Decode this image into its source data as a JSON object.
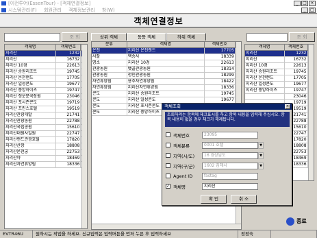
{
  "window": {
    "title": "[이전투어(EssenTour) - [객체연결정보]",
    "menu": [
      "시스템관리(F)",
      "회원관리",
      "객체정보관리",
      "창(W)"
    ]
  },
  "header": {
    "title": "객체연결정보"
  },
  "left": {
    "search_btn": "조 회",
    "col_name": "객체명",
    "col_no": "객체번호",
    "rows": [
      [
        "지리산",
        "1232"
      ],
      [
        "지리산",
        "16732"
      ],
      [
        "지리산 10경",
        "22613"
      ],
      [
        "지리산 송원리조트",
        "19745"
      ],
      [
        "지리산 온천랜드",
        "17705"
      ],
      [
        "지리산 일성콘도",
        "19677"
      ],
      [
        "지리산 중앙하이츠",
        "19747"
      ],
      [
        "지리산 청운분국장원",
        "23046"
      ],
      [
        "지리산 포시즌콘도",
        "19719"
      ],
      [
        "지리산 프린스호텔",
        "19519"
      ],
      [
        "지리산관광개발",
        "21741"
      ],
      [
        "지리산관광농원",
        "22788"
      ],
      [
        "지리산국립공원",
        "15610"
      ],
      [
        "지리산대원사일원",
        "22747"
      ],
      [
        "지리산랜드관광호텔",
        "17820"
      ],
      [
        "지리산산장",
        "18808"
      ],
      [
        "지리산온천궁",
        "22753"
      ],
      [
        "지리산야",
        "18469"
      ],
      [
        "지리산자연휴양림",
        "18336"
      ]
    ]
  },
  "tabs": [
    "상위 객체",
    "동등 객체",
    "하위 객체"
  ],
  "middle": {
    "col_class": "분류",
    "col_name": "객체명",
    "col_no": "객체번호",
    "rows": [
      [
        "온천",
        "지리산 온천랜드",
        "17705"
      ],
      [
        "사찰",
        "백승사",
        "18339"
      ],
      [
        "명소",
        "지리산 10경",
        "22613"
      ],
      [
        "관광농원",
        "뱃골관광농원",
        "18314"
      ],
      [
        "관광농원",
        "청인관광농원",
        "18299"
      ],
      [
        "자연휴양림",
        "용추자연휴양림",
        "18422"
      ],
      [
        "자연휴양림",
        "지리산자연휴양림",
        "18336"
      ],
      [
        "콘도",
        "지리산 송원리조트",
        "19745"
      ],
      [
        "콘도",
        "지리산 일성콘도",
        "19677"
      ],
      [
        "콘도",
        "지리산 포시즌콘도",
        "19719"
      ],
      [
        "콘도",
        "지리산 중앙하이츠",
        "19747"
      ]
    ]
  },
  "right": {
    "search_btn": "조 회",
    "col_name": "객체명",
    "col_no": "객체번호",
    "rows": [
      [
        "지리산",
        "1232"
      ],
      [
        "지리산",
        "16732"
      ],
      [
        "지리산 10경",
        "22613"
      ],
      [
        "지리산 송원리조트",
        "19745"
      ],
      [
        "지리산 온천랜드",
        "17705"
      ],
      [
        "지리산 일성콘도",
        "19677"
      ],
      [
        "지리산 중앙하이츠",
        "19747"
      ],
      [
        "",
        "23046"
      ],
      [
        "",
        "19719"
      ],
      [
        "",
        "19519"
      ],
      [
        "",
        "21741"
      ],
      [
        "",
        "22788"
      ],
      [
        "",
        "15610"
      ],
      [
        "",
        "22747"
      ],
      [
        "",
        "17820"
      ],
      [
        "",
        "18808"
      ],
      [
        "",
        "22753"
      ],
      [
        "",
        "18469"
      ],
      [
        "",
        "18336"
      ]
    ]
  },
  "dialog": {
    "title": "객체조회",
    "message": "조회하려는 항목에 체크표시를 하고 항목 내용을 입력해 주십시오. 항목 내용이 없을 경우 체크가 해제됩니다.",
    "fields": [
      {
        "label": "객체번호",
        "value": "23095",
        "checked": false,
        "dropdown": false
      },
      {
        "label": "객체분류",
        "value": "0001 호텔",
        "checked": false,
        "dropdown": true
      },
      {
        "label": "지역(시/도)",
        "value": "16 경상남도",
        "checked": false,
        "dropdown": true
      },
      {
        "label": "지역(구/군)",
        "value": "1602 김해시",
        "checked": false,
        "dropdown": true
      },
      {
        "label": "Agent ID",
        "value": "fastag",
        "checked": false,
        "dropdown": false
      },
      {
        "label": "객체명",
        "value": "지리산",
        "checked": true,
        "dropdown": false
      }
    ],
    "ok": "확 인",
    "cancel": "취 소"
  },
  "end_btn": "종료",
  "status": [
    "EVTR46U",
    "원하시는 작업을 하세요. 신규입력은 입력버튼을 먼저 누른 후 입력하세요",
    "정정숙",
    ""
  ],
  "colors": {
    "selection": "#1e2f8c",
    "dialog_title": "#0a246a"
  }
}
